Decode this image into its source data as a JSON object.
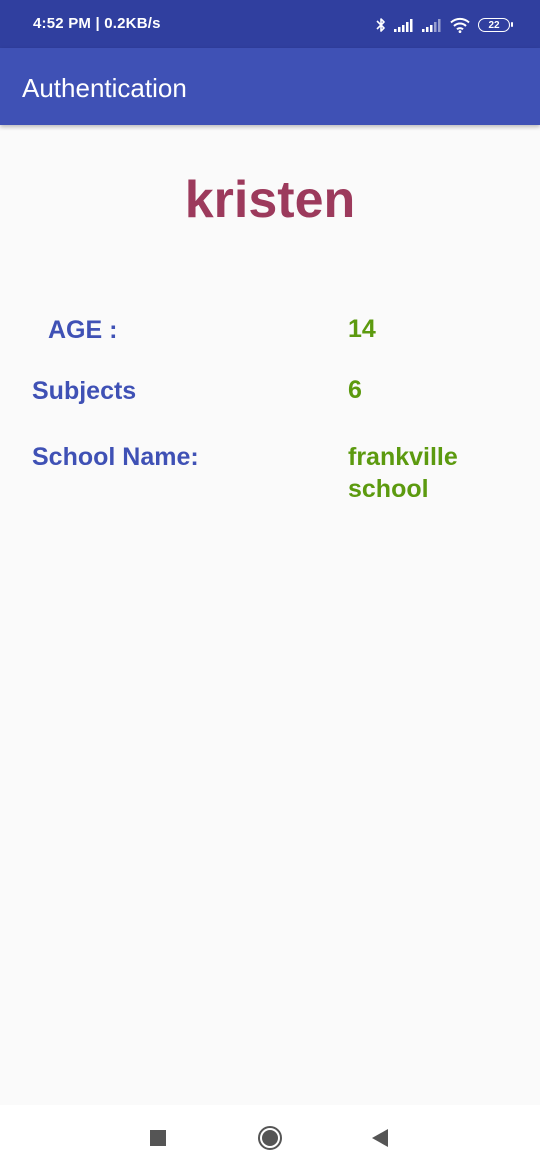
{
  "status_bar": {
    "time_speed": "4:52 PM | 0.2KB/s",
    "battery": "22",
    "icons": [
      "bluetooth-icon",
      "signal-icon",
      "signal-icon",
      "wifi-icon",
      "battery-icon"
    ]
  },
  "app_bar": {
    "title": "Authentication"
  },
  "profile": {
    "name": "kristen",
    "rows": [
      {
        "label": "AGE :",
        "value": "14"
      },
      {
        "label": "Subjects",
        "value": "6"
      },
      {
        "label": "School Name:",
        "value": "frankville\nschool"
      }
    ]
  },
  "colors": {
    "status_bar": "#303f9f",
    "app_bar": "#3f51b5",
    "name": "#9c3a5c",
    "label": "#3f51b5",
    "value": "#5c9a0f"
  },
  "nav_bar": {
    "buttons": [
      "recent-apps-button",
      "home-button",
      "back-button"
    ]
  }
}
